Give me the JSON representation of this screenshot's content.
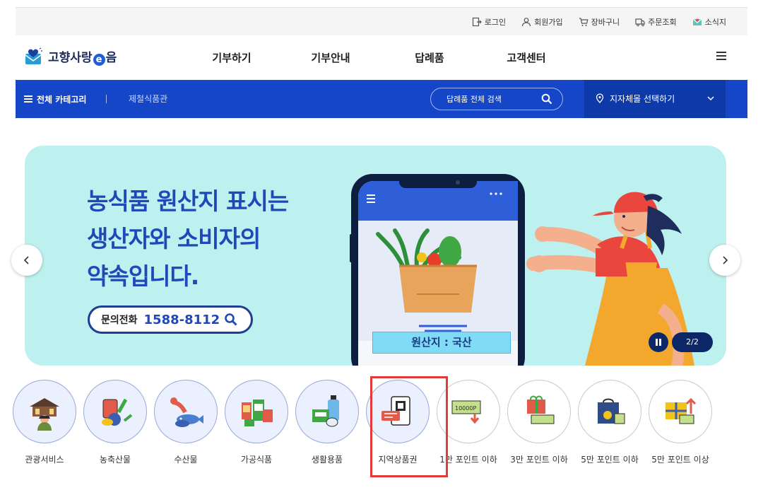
{
  "utility_links": [
    {
      "label": "로그인",
      "icon": "login-icon"
    },
    {
      "label": "회원가입",
      "icon": "user-icon"
    },
    {
      "label": "장바구니",
      "icon": "cart-icon"
    },
    {
      "label": "주문조회",
      "icon": "truck-icon"
    },
    {
      "label": "소식지",
      "icon": "newsletter-icon"
    }
  ],
  "header": {
    "logo": {
      "part1": "고향사랑",
      "part2": "e",
      "part3": "음"
    },
    "nav": [
      {
        "label": "기부하기"
      },
      {
        "label": "기부안내"
      },
      {
        "label": "답례품"
      },
      {
        "label": "고객센터"
      }
    ]
  },
  "category_bar": {
    "all_label": "전체 카테고리",
    "sub_label": "제철식품관",
    "search_placeholder": "답례품 전체 검색",
    "region_label": "지자체몰 선택하기"
  },
  "banner": {
    "headline": [
      "농식품 원산지 표시는",
      "생산자와 소비자의",
      "약속입니다."
    ],
    "hotline_label": "문의전화",
    "hotline_number": "1588-8112",
    "origin_label": "원산지 : 국산",
    "slide_counter": "2/2"
  },
  "categories": [
    {
      "label": "관광서비스",
      "icon": "tourism-icon",
      "style": "filled"
    },
    {
      "label": "농축산물",
      "icon": "agriculture-icon",
      "style": "filled"
    },
    {
      "label": "수산물",
      "icon": "seafood-icon",
      "style": "filled"
    },
    {
      "label": "가공식품",
      "icon": "processed-food-icon",
      "style": "filled"
    },
    {
      "label": "생활용품",
      "icon": "household-icon",
      "style": "filled"
    },
    {
      "label": "지역상품권",
      "icon": "voucher-icon",
      "style": "filled"
    },
    {
      "label": "1만 포인트 이하",
      "icon": "points-10k-icon",
      "style": "plain"
    },
    {
      "label": "3만 포인트 이하",
      "icon": "gift-30k-icon",
      "style": "plain"
    },
    {
      "label": "5만 포인트 이하",
      "icon": "bag-50k-icon",
      "style": "plain"
    },
    {
      "label": "5만 포인트 이상",
      "icon": "gift-over-50k-icon",
      "style": "plain"
    }
  ],
  "colors": {
    "brand_blue": "#1446c7",
    "banner_bg": "#bdf1ef",
    "headline": "#1f48b8",
    "highlight": "#e23b3b"
  }
}
